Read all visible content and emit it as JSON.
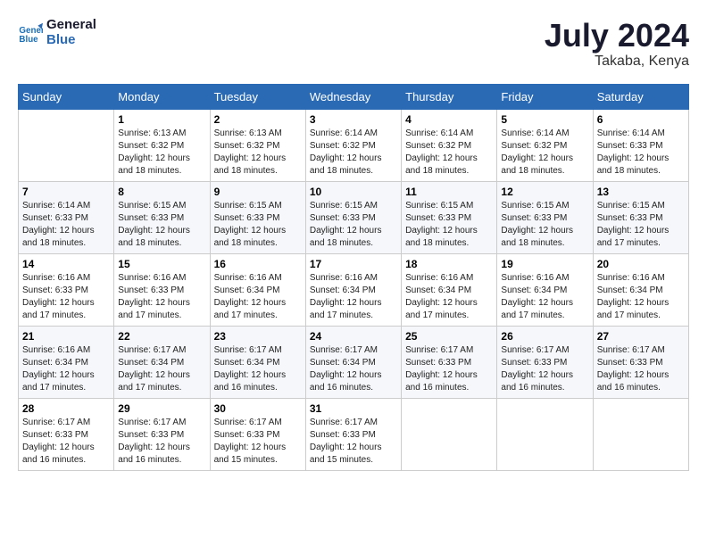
{
  "header": {
    "logo_line1": "General",
    "logo_line2": "Blue",
    "month_year": "July 2024",
    "location": "Takaba, Kenya"
  },
  "calendar": {
    "days_of_week": [
      "Sunday",
      "Monday",
      "Tuesday",
      "Wednesday",
      "Thursday",
      "Friday",
      "Saturday"
    ],
    "weeks": [
      [
        {
          "day": "",
          "info": ""
        },
        {
          "day": "1",
          "info": "Sunrise: 6:13 AM\nSunset: 6:32 PM\nDaylight: 12 hours and 18 minutes."
        },
        {
          "day": "2",
          "info": "Sunrise: 6:13 AM\nSunset: 6:32 PM\nDaylight: 12 hours and 18 minutes."
        },
        {
          "day": "3",
          "info": "Sunrise: 6:14 AM\nSunset: 6:32 PM\nDaylight: 12 hours and 18 minutes."
        },
        {
          "day": "4",
          "info": "Sunrise: 6:14 AM\nSunset: 6:32 PM\nDaylight: 12 hours and 18 minutes."
        },
        {
          "day": "5",
          "info": "Sunrise: 6:14 AM\nSunset: 6:32 PM\nDaylight: 12 hours and 18 minutes."
        },
        {
          "day": "6",
          "info": "Sunrise: 6:14 AM\nSunset: 6:33 PM\nDaylight: 12 hours and 18 minutes."
        }
      ],
      [
        {
          "day": "7",
          "info": "Sunrise: 6:14 AM\nSunset: 6:33 PM\nDaylight: 12 hours and 18 minutes."
        },
        {
          "day": "8",
          "info": "Sunrise: 6:15 AM\nSunset: 6:33 PM\nDaylight: 12 hours and 18 minutes."
        },
        {
          "day": "9",
          "info": "Sunrise: 6:15 AM\nSunset: 6:33 PM\nDaylight: 12 hours and 18 minutes."
        },
        {
          "day": "10",
          "info": "Sunrise: 6:15 AM\nSunset: 6:33 PM\nDaylight: 12 hours and 18 minutes."
        },
        {
          "day": "11",
          "info": "Sunrise: 6:15 AM\nSunset: 6:33 PM\nDaylight: 12 hours and 18 minutes."
        },
        {
          "day": "12",
          "info": "Sunrise: 6:15 AM\nSunset: 6:33 PM\nDaylight: 12 hours and 18 minutes."
        },
        {
          "day": "13",
          "info": "Sunrise: 6:15 AM\nSunset: 6:33 PM\nDaylight: 12 hours and 17 minutes."
        }
      ],
      [
        {
          "day": "14",
          "info": "Sunrise: 6:16 AM\nSunset: 6:33 PM\nDaylight: 12 hours and 17 minutes."
        },
        {
          "day": "15",
          "info": "Sunrise: 6:16 AM\nSunset: 6:33 PM\nDaylight: 12 hours and 17 minutes."
        },
        {
          "day": "16",
          "info": "Sunrise: 6:16 AM\nSunset: 6:34 PM\nDaylight: 12 hours and 17 minutes."
        },
        {
          "day": "17",
          "info": "Sunrise: 6:16 AM\nSunset: 6:34 PM\nDaylight: 12 hours and 17 minutes."
        },
        {
          "day": "18",
          "info": "Sunrise: 6:16 AM\nSunset: 6:34 PM\nDaylight: 12 hours and 17 minutes."
        },
        {
          "day": "19",
          "info": "Sunrise: 6:16 AM\nSunset: 6:34 PM\nDaylight: 12 hours and 17 minutes."
        },
        {
          "day": "20",
          "info": "Sunrise: 6:16 AM\nSunset: 6:34 PM\nDaylight: 12 hours and 17 minutes."
        }
      ],
      [
        {
          "day": "21",
          "info": "Sunrise: 6:16 AM\nSunset: 6:34 PM\nDaylight: 12 hours and 17 minutes."
        },
        {
          "day": "22",
          "info": "Sunrise: 6:17 AM\nSunset: 6:34 PM\nDaylight: 12 hours and 17 minutes."
        },
        {
          "day": "23",
          "info": "Sunrise: 6:17 AM\nSunset: 6:34 PM\nDaylight: 12 hours and 16 minutes."
        },
        {
          "day": "24",
          "info": "Sunrise: 6:17 AM\nSunset: 6:34 PM\nDaylight: 12 hours and 16 minutes."
        },
        {
          "day": "25",
          "info": "Sunrise: 6:17 AM\nSunset: 6:33 PM\nDaylight: 12 hours and 16 minutes."
        },
        {
          "day": "26",
          "info": "Sunrise: 6:17 AM\nSunset: 6:33 PM\nDaylight: 12 hours and 16 minutes."
        },
        {
          "day": "27",
          "info": "Sunrise: 6:17 AM\nSunset: 6:33 PM\nDaylight: 12 hours and 16 minutes."
        }
      ],
      [
        {
          "day": "28",
          "info": "Sunrise: 6:17 AM\nSunset: 6:33 PM\nDaylight: 12 hours and 16 minutes."
        },
        {
          "day": "29",
          "info": "Sunrise: 6:17 AM\nSunset: 6:33 PM\nDaylight: 12 hours and 16 minutes."
        },
        {
          "day": "30",
          "info": "Sunrise: 6:17 AM\nSunset: 6:33 PM\nDaylight: 12 hours and 15 minutes."
        },
        {
          "day": "31",
          "info": "Sunrise: 6:17 AM\nSunset: 6:33 PM\nDaylight: 12 hours and 15 minutes."
        },
        {
          "day": "",
          "info": ""
        },
        {
          "day": "",
          "info": ""
        },
        {
          "day": "",
          "info": ""
        }
      ]
    ]
  }
}
